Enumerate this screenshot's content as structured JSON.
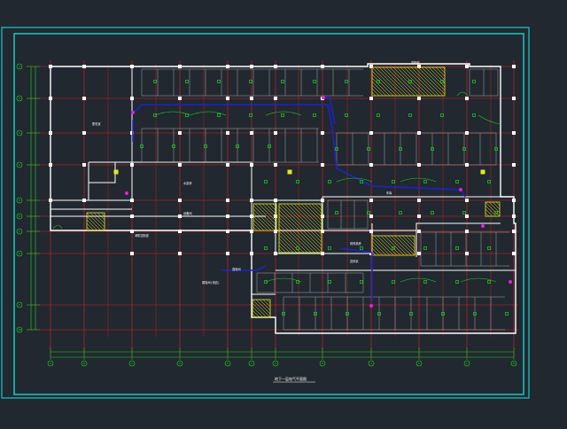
{
  "drawing": {
    "background": "#212830",
    "frame_color": "#19c8c8",
    "axis_color": "#e02020",
    "wall_color": "#ffffff",
    "pipe_color": "#1e22c8",
    "device_color": "#21d321",
    "hatch_color": "#e6e61e",
    "dim_color": "#21d321",
    "title_block_text": "地下一层电气平面图",
    "room_labels": {
      "upper_left": "配电室",
      "mid_center": "水泵房",
      "mid_center2": "设备间",
      "left_lower": "消防控制室",
      "top_right": "变配电",
      "mid_right": "车库",
      "center_small1": "排风机房",
      "center_small2": "送风机",
      "lower_left1": "强电间",
      "lower_left2": "弱电间(电信)"
    },
    "row_axes": [
      "1",
      "2",
      "3",
      "4",
      "5",
      "6",
      "7",
      "8",
      "9",
      "10"
    ],
    "col_axes": [
      "A",
      "B",
      "C",
      "D",
      "E",
      "F",
      "G",
      "H",
      "J",
      "K",
      "L",
      "M"
    ]
  }
}
